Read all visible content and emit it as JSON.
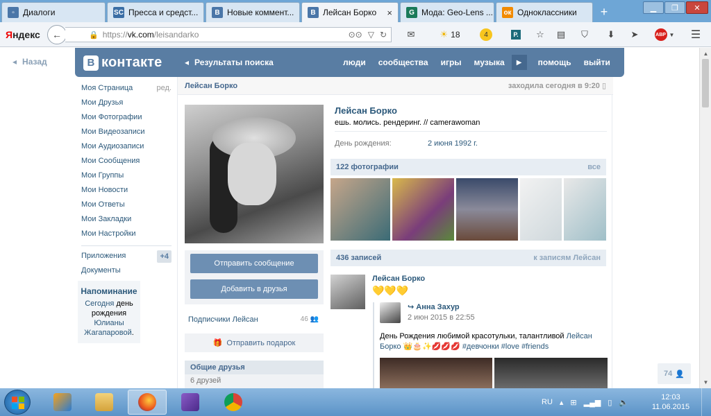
{
  "browser": {
    "tabs": [
      {
        "title": "Диалоги",
        "favicon": "vk-dialog-icon",
        "color": "#4a76a8",
        "glyph": "▫"
      },
      {
        "title": "Пресса и средст...",
        "favicon": "sc-icon",
        "color": "#3b6ea5",
        "glyph": "SC"
      },
      {
        "title": "Новые коммент...",
        "favicon": "vk-icon",
        "color": "#4a76a8",
        "glyph": "В"
      },
      {
        "title": "Лейсан Борко",
        "favicon": "vk-icon",
        "color": "#4a76a8",
        "glyph": "В",
        "active": true
      },
      {
        "title": "Мода: Geo-Lens ...",
        "favicon": "g-icon",
        "color": "#1a7a5a",
        "glyph": "G"
      },
      {
        "title": "Одноклассники",
        "favicon": "ok-icon",
        "color": "#f28a00",
        "glyph": "ок"
      }
    ],
    "new_tab": "+",
    "yandex_brand_first": "Я",
    "yandex_brand_rest": "ндекс",
    "url_proto": "https://",
    "url_host": "vk.com",
    "url_path": "/leisandarko",
    "weather_temp": "18",
    "badge_count": "4",
    "adblock": "ABP"
  },
  "vk": {
    "back": "Назад",
    "logo": "контакте",
    "logo_b": "В",
    "search_results": "Результаты поиска",
    "menu": [
      "люди",
      "сообщества",
      "игры",
      "музыка",
      "помощь",
      "выйти"
    ],
    "left_menu": [
      {
        "label": "Моя Страница",
        "sub": "ред."
      },
      {
        "label": "Мои Друзья"
      },
      {
        "label": "Мои Фотографии"
      },
      {
        "label": "Мои Видеозаписи"
      },
      {
        "label": "Мои Аудиозаписи"
      },
      {
        "label": "Мои Сообщения"
      },
      {
        "label": "Мои Группы"
      },
      {
        "label": "Мои Новости"
      },
      {
        "label": "Мои Ответы"
      },
      {
        "label": "Мои Закладки"
      },
      {
        "label": "Мои Настройки"
      }
    ],
    "apps": "Приложения",
    "apps_badge": "+4",
    "docs": "Документы",
    "reminder": {
      "title": "Напоминание",
      "today": "Сегодня",
      "text1": "день рождения",
      "name": "Юлианы Жагапаровой",
      "dot": "."
    },
    "profile": {
      "top_name": "Лейсан Борко",
      "last_seen": "заходила сегодня в 9:20",
      "name": "Лейсан Борко",
      "status": "ешь. молись. рендеринг. // camerawoman",
      "bd_label": "День рождения:",
      "bd_value": "2 июня 1992 г.",
      "send_message": "Отправить сообщение",
      "add_friend": "Добавить в друзья",
      "subscribers": "Подписчики Лейсан",
      "subscribers_count": "46",
      "gift": "Отправить подарок",
      "mutual_friends": "Общие друзья",
      "mutual_count": "6 друзей"
    },
    "photos": {
      "count": "122 фотографии",
      "all": "все"
    },
    "wall": {
      "count": "436 записей",
      "to_posts": "к записям Лейсан",
      "author": "Лейсан Борко",
      "hearts": "💛💛💛",
      "repost_author": "Анна Захур",
      "repost_date": "2 июн 2015 в 22:55",
      "text_a": "День Рождения любимой красотульки, талантливой ",
      "text_link": "Лейсан Борко",
      "text_emoji": " 👑🎂✨💋💋💋 ",
      "text_tags": "#девчонки #love #friends"
    },
    "likes": "74"
  },
  "taskbar": {
    "lang": "RU",
    "time": "12:03",
    "date": "11.06.2015"
  }
}
